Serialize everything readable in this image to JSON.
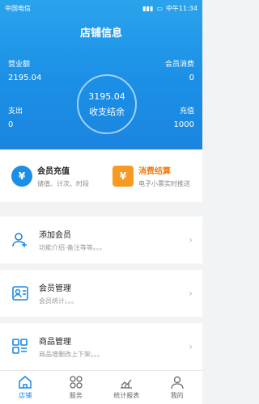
{
  "statusbar": {
    "carrier": "中国电信",
    "time": "中午11:34"
  },
  "header": {
    "title": "店铺信息"
  },
  "stats": {
    "revenue_label": "营业额",
    "revenue_value": "2195.04",
    "member_spend_label": "会员消费",
    "member_spend_value": "0",
    "expense_label": "支出",
    "expense_value": "0",
    "recharge_label": "充值",
    "recharge_value": "1000",
    "balance_value": "3195.04",
    "balance_label": "收支结余"
  },
  "quick_actions": [
    {
      "title": "会员充值",
      "subtitle": "储值、计次、时段",
      "icon": "yen-icon",
      "color": "#1b8fe6"
    },
    {
      "title": "消费结算",
      "subtitle": "电子小票实时推送",
      "icon": "receipt-icon",
      "color": "#f59a23"
    }
  ],
  "rows": [
    {
      "title": "添加会员",
      "subtitle": "功能介绍-备注等等。。。",
      "icon": "add-user-icon"
    },
    {
      "title": "会员管理",
      "subtitle": "会员统计。。。",
      "icon": "member-card-icon"
    },
    {
      "title": "商品管理",
      "subtitle": "商品增删改上下架。。。",
      "icon": "goods-grid-icon"
    }
  ],
  "tabs": [
    {
      "label": "店铺",
      "icon": "home-icon",
      "active": true
    },
    {
      "label": "服务",
      "icon": "service-icon",
      "active": false
    },
    {
      "label": "统计报表",
      "icon": "chart-icon",
      "active": false
    },
    {
      "label": "我的",
      "icon": "profile-icon",
      "active": false
    }
  ]
}
